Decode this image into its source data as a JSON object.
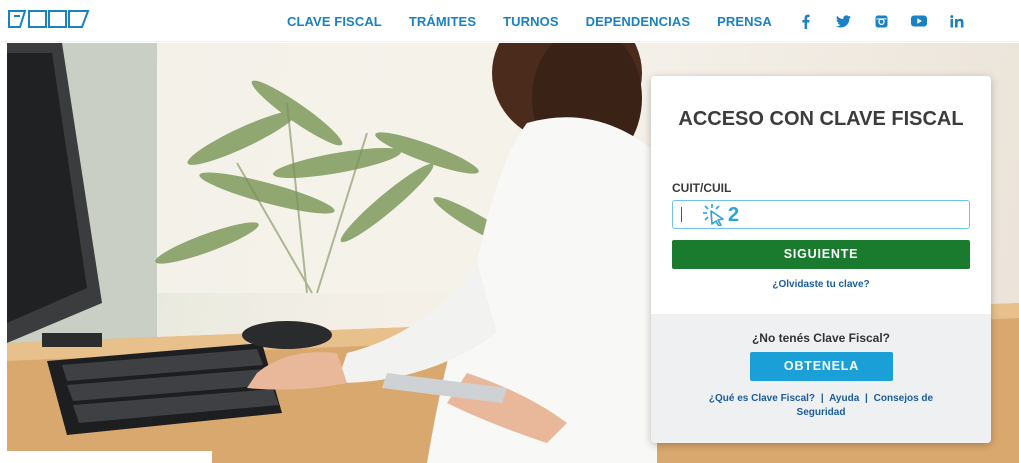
{
  "nav": {
    "items": [
      {
        "label": "CLAVE FISCAL"
      },
      {
        "label": "TRÁMITES"
      },
      {
        "label": "TURNOS"
      },
      {
        "label": "DEPENDENCIAS"
      },
      {
        "label": "PRENSA"
      }
    ],
    "socials": [
      "facebook-icon",
      "twitter-icon",
      "instagram-icon",
      "youtube-icon",
      "linkedin-icon"
    ],
    "accent": "#1a82c2"
  },
  "login": {
    "title": "ACCESO CON CLAVE FISCAL",
    "field_label": "CUIT/CUIL",
    "field_value": "",
    "cursor_annotation": "2",
    "next_button": "SIGUIENTE",
    "forgot_link": "¿Olvidaste tu clave?",
    "no_clave_text": "¿No tenés Clave Fiscal?",
    "get_button": "OBTENELA",
    "link_what": "¿Qué es Clave Fiscal?",
    "link_help": "Ayuda",
    "link_security": "Consejos de Seguridad",
    "separator": "|",
    "colors": {
      "next_button": "#1a7a2e",
      "get_button": "#1aa0d7",
      "field_border": "#6fc3e8"
    }
  }
}
